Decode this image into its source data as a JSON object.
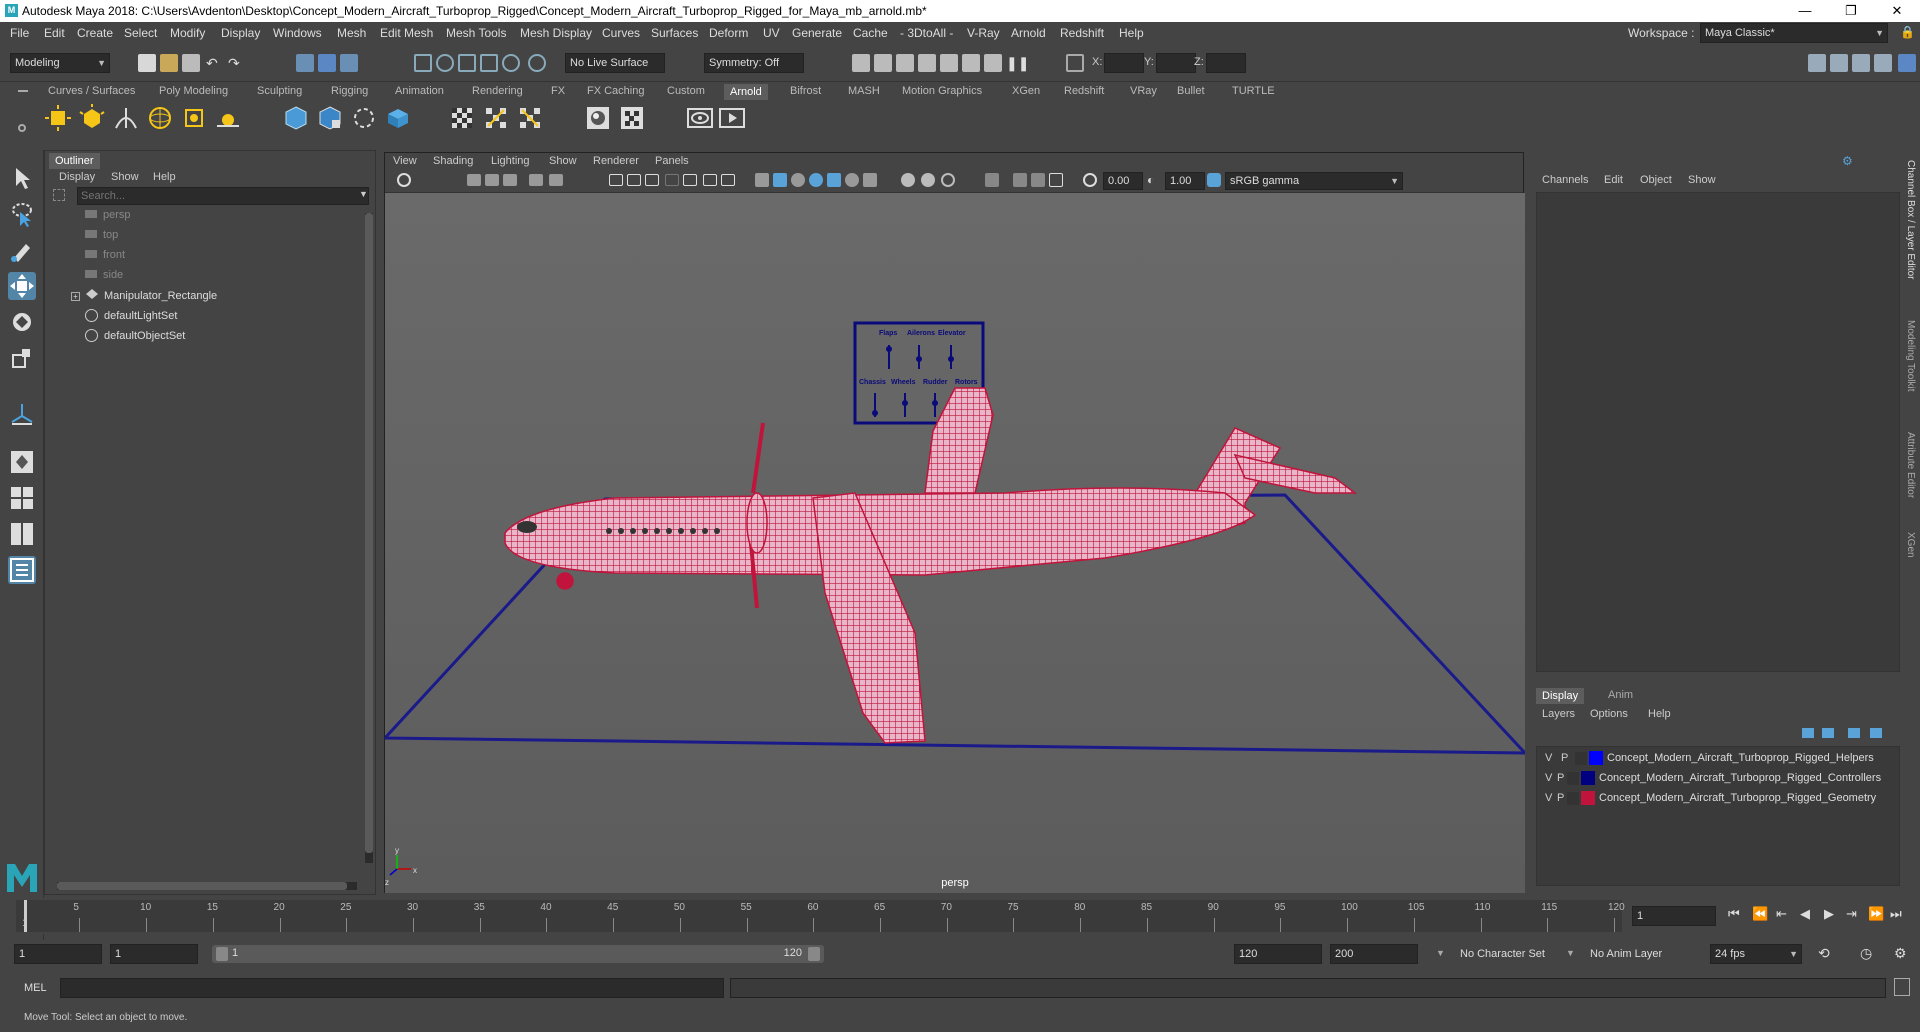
{
  "window": {
    "title": "Autodesk Maya 2018: C:\\Users\\Avdenton\\Desktop\\Concept_Modern_Aircraft_Turboprop_Rigged\\Concept_Modern_Aircraft_Turboprop_Rigged_for_Maya_mb_arnold.mb*",
    "logo": "M",
    "minimize": "—",
    "maximize": "❐",
    "close": "✕"
  },
  "menubar": [
    "File",
    "Edit",
    "Create",
    "Select",
    "Modify",
    "Display",
    "Windows",
    "Mesh",
    "Edit Mesh",
    "Mesh Tools",
    "Mesh Display",
    "Curves",
    "Surfaces",
    "Deform",
    "UV",
    "Generate",
    "Cache",
    "- 3DtoAll -",
    "V-Ray",
    "Arnold",
    "Redshift",
    "Help"
  ],
  "workspace": {
    "label": "Workspace :",
    "value": "Maya Classic*"
  },
  "statusline": {
    "mode": "Modeling",
    "live_surface": "No Live Surface",
    "symmetry": "Symmetry: Off",
    "x_label": "X:",
    "y_label": "Y:",
    "z_label": "Z:"
  },
  "shelf": {
    "tabs": [
      "Curves / Surfaces",
      "Poly Modeling",
      "Sculpting",
      "Rigging",
      "Animation",
      "Rendering",
      "FX",
      "FX Caching",
      "Custom",
      "Arnold",
      "Bifrost",
      "MASH",
      "Motion Graphics",
      "XGen",
      "Redshift",
      "VRay",
      "Bullet",
      "TURTLE"
    ],
    "active": "Arnold"
  },
  "outliner": {
    "title": "Outliner",
    "menu": [
      "Display",
      "Show",
      "Help"
    ],
    "search_placeholder": "Search...",
    "items": [
      {
        "label": "persp",
        "dim": true
      },
      {
        "label": "top",
        "dim": true
      },
      {
        "label": "front",
        "dim": true
      },
      {
        "label": "side",
        "dim": true
      },
      {
        "label": "Manipulator_Rectangle",
        "dim": false
      },
      {
        "label": "defaultLightSet",
        "dim": false
      },
      {
        "label": "defaultObjectSet",
        "dim": false
      }
    ]
  },
  "viewport": {
    "menu": [
      "View",
      "Shading",
      "Lighting",
      "Show",
      "Renderer",
      "Panels"
    ],
    "exposure": "0.00",
    "gamma": "1.00",
    "color_space": "sRGB gamma",
    "camera_label": "persp",
    "controller_labels_top": [
      "Flaps",
      "Ailerons",
      "Elevator"
    ],
    "controller_labels_bottom": [
      "Chassis",
      "Wheels",
      "Rudder",
      "Rotors"
    ],
    "axis": {
      "x": "x",
      "y": "y",
      "z": "z"
    }
  },
  "channelbox": {
    "menu": [
      "Channels",
      "Edit",
      "Object",
      "Show"
    ]
  },
  "layers": {
    "tabs": [
      "Display",
      "Anim"
    ],
    "menu": [
      "Layers",
      "Options",
      "Help"
    ],
    "rows": [
      {
        "v": "V",
        "p": "P",
        "color": "#0000ff",
        "name": "Concept_Modern_Aircraft_Turboprop_Rigged_Helpers"
      },
      {
        "v": "V",
        "p": "P",
        "color": "#000080",
        "name": "Concept_Modern_Aircraft_Turboprop_Rigged_Controllers"
      },
      {
        "v": "V",
        "p": "P",
        "color": "#c0143c",
        "name": "Concept_Modern_Aircraft_Turboprop_Rigged_Geometry"
      }
    ]
  },
  "side_tabs": [
    "Channel Box / Layer Editor",
    "Modeling Toolkit",
    "Attribute Editor",
    "XGen"
  ],
  "timeslider": {
    "ticks": [
      "5",
      "10",
      "15",
      "20",
      "25",
      "30",
      "35",
      "40",
      "45",
      "50",
      "55",
      "60",
      "65",
      "70",
      "75",
      "80",
      "85",
      "90",
      "95",
      "100",
      "105",
      "110",
      "115",
      "120"
    ],
    "start_tick": "1",
    "current_frame": "1"
  },
  "range": {
    "start": "1",
    "playback_start": "1",
    "range_start": "1",
    "range_end": "120",
    "playback_end": "120",
    "end": "200",
    "character_set": "No Character Set",
    "anim_layer": "No Anim Layer",
    "fps": "24 fps"
  },
  "cmdline": {
    "label": "MEL"
  },
  "helpline": {
    "text": "Move Tool: Select an object to move."
  },
  "colors": {
    "wire": "#c0143c",
    "controller": "#000080"
  }
}
